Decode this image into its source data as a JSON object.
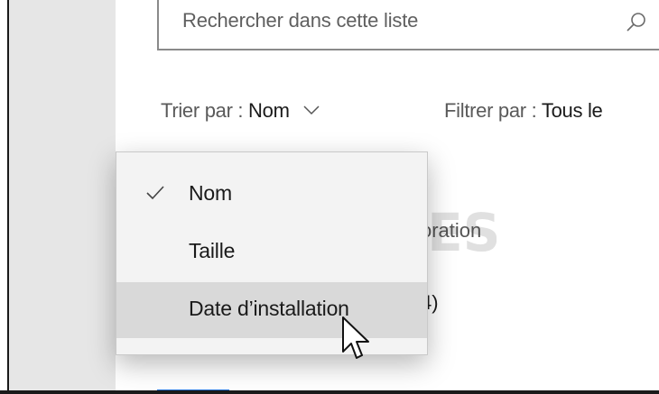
{
  "search": {
    "placeholder": "Rechercher dans cette liste",
    "icon": "search-icon"
  },
  "sort": {
    "label": "Trier par :",
    "value": "Nom"
  },
  "filter": {
    "label": "Filtrer par :",
    "value": "Tous le"
  },
  "background": {
    "line1": "oration",
    "line2": "4)"
  },
  "menu": {
    "items": [
      {
        "label": "Nom",
        "selected": true
      },
      {
        "label": "Taille",
        "selected": false
      },
      {
        "label": "Date d’installation",
        "selected": false,
        "hovered": true
      }
    ]
  },
  "watermark": {
    "text": "PC ASTUCES"
  },
  "colors": {
    "accent": "#1f6fd6",
    "hover": "#d9d9d9",
    "menu_bg": "#f3f3f3",
    "sidebar": "#e6e6e6"
  }
}
